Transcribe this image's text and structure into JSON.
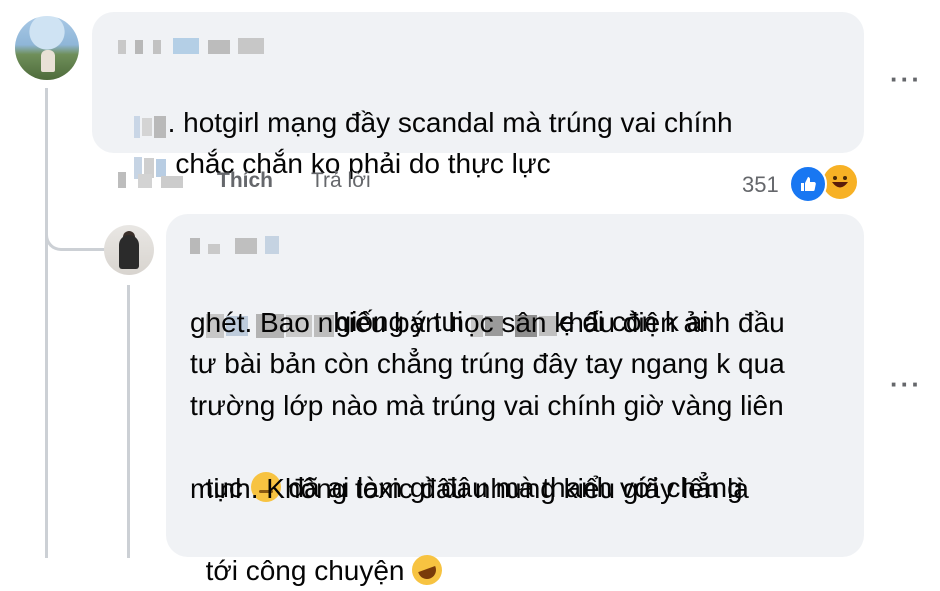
{
  "comment": {
    "text_line1": "hotgirl mạng đầy scandal mà trúng vai chính",
    "text_line2": "chắc chắn ko phải do thực lực",
    "like_label": "Thích",
    "reply_label": "Trả lời",
    "reaction_count": "351",
    "reaction_icons": [
      "like-icon",
      "haha-icon"
    ]
  },
  "reply": {
    "text_line1_visible": "giống ý tui",
    "text_line1_end": "ẹ đi còn k ai",
    "text_line2": "ghét. Bao nhiêu bạn học sân khấu điện ảnh đầu",
    "text_line3": "tư bài bản còn chẳng trúng đây tay ngang k qua",
    "text_line4": "trường lớp nào mà trúng vai chính giờ vàng liên",
    "text_line5_start": "tục",
    "text_line5_end": "đã ai làm gì đâu mà thanh với chẳng",
    "text_line6": "minh. Không toxic đâu nhưng kiểu giãy lên là",
    "text_line7": "tới công chuyện",
    "emoji_1": "sad-face-icon",
    "emoji_2": "rolling-laugh-icon"
  },
  "more_menu_glyph": "···",
  "colors": {
    "bubble_bg": "#f0f2f5",
    "meta_text": "#65676b",
    "like_blue": "#1877f2",
    "haha_yellow": "#f7b125"
  }
}
